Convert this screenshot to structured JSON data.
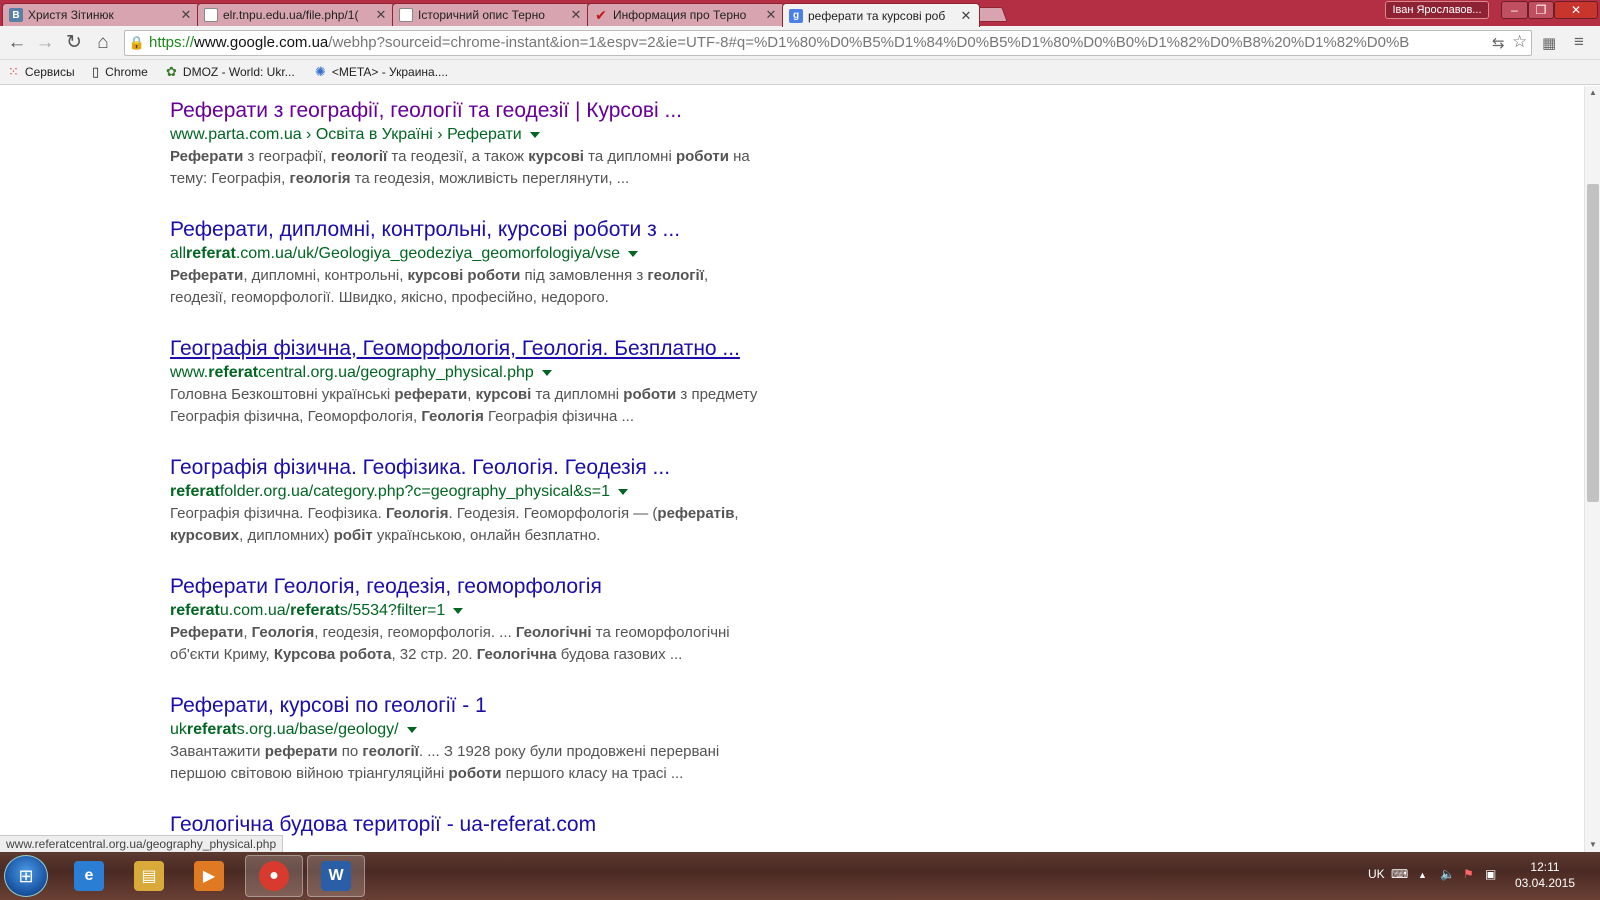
{
  "tabs": [
    {
      "title": "Христя Зітинюк",
      "icon": "vk-icon",
      "active": false
    },
    {
      "title": "elr.tnpu.edu.ua/file.php/1(",
      "icon": "document-icon",
      "active": false
    },
    {
      "title": "Історичний опис Терно",
      "icon": "document-icon",
      "active": false
    },
    {
      "title": "Информация про Терно",
      "icon": "checkmark-icon",
      "active": false
    },
    {
      "title": "реферати та курсові роб",
      "icon": "google-icon",
      "active": true
    }
  ],
  "window": {
    "user": "Іван Ярославов..."
  },
  "omnibox": {
    "scheme": "https://",
    "host": "www.google.com.ua",
    "rest": "/webhp?sourceid=chrome-instant&ion=1&espv=2&ie=UTF-8#q=%D1%80%D0%B5%D1%84%D0%B5%D1%80%D0%B0%D1%82%D0%B8%20%D1%82%D0%B"
  },
  "bookmarks": [
    {
      "label": "Сервисы",
      "icon": "apps-grid-icon"
    },
    {
      "label": "Chrome",
      "icon": "page-icon"
    },
    {
      "label": "DMOZ - World: Ukr...",
      "icon": "dmoz-icon"
    },
    {
      "label": "<META> - Украина....",
      "icon": "meta-icon"
    }
  ],
  "results": [
    {
      "title": "Реферати з географії, геології та геодезії | Курсові ...",
      "url": [
        [
          "",
          "www.parta.com.ua › Освіта в Україні › Реферати"
        ]
      ],
      "snippet": [
        [
          [
            "b",
            "Реферати"
          ],
          [
            "",
            "з географії, "
          ],
          [
            "b",
            "геології"
          ],
          [
            "",
            "та геодезії, а також "
          ],
          [
            "b",
            "курсові"
          ],
          [
            "",
            "та дипломні "
          ],
          [
            "b",
            "роботи"
          ],
          [
            "",
            "на"
          ]
        ],
        [
          [
            "",
            "тему: Географія, "
          ],
          [
            "b",
            "геологія"
          ],
          [
            "",
            "та геодезія, можливість переглянути, ..."
          ]
        ]
      ],
      "visited": true,
      "hover": false
    },
    {
      "title": "Реферати, дипломні, контрольні, курсові роботи з ...",
      "url": [
        [
          "",
          "all"
        ],
        [
          "b",
          "referat"
        ],
        [
          "",
          ".com.ua/uk/Geologiya_geodeziya_geomorfologiya/vse"
        ]
      ],
      "snippet": [
        [
          [
            "b",
            "Реферати"
          ],
          [
            "",
            ", дипломні, контрольні, "
          ],
          [
            "b",
            "курсові роботи"
          ],
          [
            "",
            "під замовлення з "
          ],
          [
            "b",
            "геології"
          ],
          [
            "",
            ","
          ]
        ],
        [
          [
            "",
            "геодезії, геоморфології. Швидко, якісно, професійно, недорого."
          ]
        ]
      ],
      "visited": false,
      "hover": false
    },
    {
      "title": "Географія фізична, Геоморфологія, Геологія. Безплатно ...",
      "url": [
        [
          "",
          "www."
        ],
        [
          "b",
          "referat"
        ],
        [
          "",
          "central.org.ua/geography_physical.php"
        ]
      ],
      "snippet": [
        [
          [
            "",
            "Головна Безкоштовні українські "
          ],
          [
            "b",
            "реферати"
          ],
          [
            "",
            ", "
          ],
          [
            "b",
            "курсові"
          ],
          [
            "",
            "та дипломні "
          ],
          [
            "b",
            "роботи"
          ],
          [
            "",
            "з предмету"
          ]
        ],
        [
          [
            "",
            "Географія фізична, Геоморфологія, "
          ],
          [
            "b",
            "Геологія"
          ],
          [
            "",
            "Географія фізична  ..."
          ]
        ]
      ],
      "visited": false,
      "hover": true
    },
    {
      "title": "Географія фізична. Геофізика. Геологія. Геодезія ...",
      "url": [
        [
          "b",
          "referat"
        ],
        [
          "",
          "folder.org.ua/category.php?c=geography_physical&s=1"
        ]
      ],
      "snippet": [
        [
          [
            "",
            "Географія фізична. Геофізика. "
          ],
          [
            "b",
            "Геологія"
          ],
          [
            "",
            ". Геодезія. Геоморфологія — ("
          ],
          [
            "b",
            "рефератів"
          ],
          [
            "",
            ","
          ]
        ],
        [
          [
            "b",
            "курсових"
          ],
          [
            "",
            ", дипломних) "
          ],
          [
            "b",
            "робіт"
          ],
          [
            "",
            "українською, онлайн безплатно."
          ]
        ]
      ],
      "visited": false,
      "hover": false
    },
    {
      "title": "Реферати Геологія, геодезія, геоморфологія",
      "url": [
        [
          "b",
          "referat"
        ],
        [
          "",
          "u.com.ua/"
        ],
        [
          "b",
          "referat"
        ],
        [
          "",
          "s/5534?filter=1"
        ]
      ],
      "snippet": [
        [
          [
            "b",
            "Реферати"
          ],
          [
            "",
            ", "
          ],
          [
            "b",
            "Геологія"
          ],
          [
            "",
            ", геодезія, геоморфологія. ... "
          ],
          [
            "b",
            "Геологічні"
          ],
          [
            "",
            "та геоморфологічні"
          ]
        ],
        [
          [
            "",
            "об'єкти Криму, "
          ],
          [
            "b",
            "Курсова робота"
          ],
          [
            "",
            ", 32 стр. 20. "
          ],
          [
            "b",
            "Геологічна"
          ],
          [
            "",
            "будова газових  ..."
          ]
        ]
      ],
      "visited": false,
      "hover": false
    },
    {
      "title": "Реферати, курсові по геології - 1",
      "url": [
        [
          "",
          "uk"
        ],
        [
          "b",
          "referat"
        ],
        [
          "",
          "s.org.ua/base/geology/"
        ]
      ],
      "snippet": [
        [
          [
            "",
            "Завантажити "
          ],
          [
            "b",
            "реферати"
          ],
          [
            "",
            "по "
          ],
          [
            "b",
            "геології"
          ],
          [
            "",
            ". ... З 1928 року були продовжені перервані"
          ]
        ],
        [
          [
            "",
            "першою світовою війною тріангуляційні "
          ],
          [
            "b",
            "роботи"
          ],
          [
            "",
            "першого класу на трасі  ..."
          ]
        ]
      ],
      "visited": false,
      "hover": false
    },
    {
      "title": "Геологічна будова території - ua-referat.com",
      "url": [],
      "snippet": [],
      "visited": false,
      "hover": false
    }
  ],
  "status_bar": {
    "url": "www.referatcentral.org.ua/geography_physical.php"
  },
  "taskbar": {
    "apps": [
      {
        "name": "internet-explorer",
        "glyph": "e",
        "color": "#2a7fd4"
      },
      {
        "name": "file-explorer",
        "glyph": "▤",
        "color": "#d9a93a"
      },
      {
        "name": "media-player",
        "glyph": "▶",
        "color": "#e07a22"
      },
      {
        "name": "chrome",
        "glyph": "●",
        "color": "#d93a2e"
      },
      {
        "name": "word",
        "glyph": "W",
        "color": "#2a5fa8"
      }
    ],
    "language": "UK",
    "time": "12:11",
    "date": "03.04.2015"
  },
  "colors": {
    "link": "#1a0dab",
    "visited": "#660099",
    "url_green": "#006621",
    "snippet": "#545454",
    "tabstrip": "#b42e44"
  }
}
